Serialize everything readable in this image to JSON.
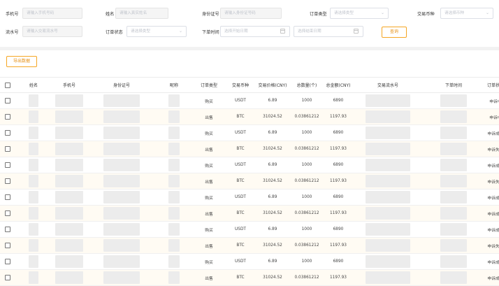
{
  "filters": {
    "phone_label": "手机号",
    "phone_placeholder": "请输入手机号码",
    "name_label": "姓名",
    "name_placeholder": "请输入真实姓名",
    "idcard_label": "身份证号",
    "idcard_placeholder": "请输入身份证号码",
    "order_type_label": "订单类型",
    "order_type_placeholder": "请选择类型",
    "trade_coin_label": "交易币种",
    "trade_coin_placeholder": "请选择币种",
    "serial_label": "流水号",
    "serial_placeholder": "请输入交易流水号",
    "order_status_label": "订单状态",
    "order_status_placeholder": "请选择类型",
    "order_time_label": "下单时间",
    "start_date_placeholder": "选择开始日期",
    "end_date_placeholder": "选择结束日期",
    "search_button": "查询"
  },
  "export_button": "导出数据",
  "table": {
    "headers": [
      "姓名",
      "手机号",
      "身份证号",
      "昵称",
      "订单类型",
      "交易币种",
      "交易价格(CNY)",
      "总数量(个)",
      "总金额(CNY)",
      "交易流水号",
      "下单时间",
      "订单状态"
    ],
    "rows": [
      {
        "type": "购买",
        "coin": "USDT",
        "price": "6.89",
        "qty": "1000",
        "amount": "6890",
        "status": "申诉中"
      },
      {
        "type": "出售",
        "coin": "BTC",
        "price": "31024.52",
        "qty": "0.03861212",
        "amount": "1197.93",
        "status": "申诉中"
      },
      {
        "type": "购买",
        "coin": "USDT",
        "price": "6.89",
        "qty": "1000",
        "amount": "6890",
        "status": "申诉成功"
      },
      {
        "type": "出售",
        "coin": "BTC",
        "price": "31024.52",
        "qty": "0.03861212",
        "amount": "1197.93",
        "status": "申诉失败"
      },
      {
        "type": "购买",
        "coin": "USDT",
        "price": "6.89",
        "qty": "1000",
        "amount": "6890",
        "status": "申诉成功"
      },
      {
        "type": "出售",
        "coin": "BTC",
        "price": "31024.52",
        "qty": "0.03861212",
        "amount": "1197.93",
        "status": "申诉失败"
      },
      {
        "type": "购买",
        "coin": "USDT",
        "price": "6.89",
        "qty": "1000",
        "amount": "6890",
        "status": "申诉成功"
      },
      {
        "type": "出售",
        "coin": "BTC",
        "price": "31024.52",
        "qty": "0.03861212",
        "amount": "1197.93",
        "status": "申诉成功"
      },
      {
        "type": "购买",
        "coin": "USDT",
        "price": "6.89",
        "qty": "1000",
        "amount": "6890",
        "status": "申诉成功"
      },
      {
        "type": "出售",
        "coin": "BTC",
        "price": "31024.52",
        "qty": "0.03861212",
        "amount": "1197.93",
        "status": "申诉失败"
      },
      {
        "type": "购买",
        "coin": "USDT",
        "price": "6.89",
        "qty": "1000",
        "amount": "6890",
        "status": "申诉成功"
      },
      {
        "type": "出售",
        "coin": "BTC",
        "price": "31024.52",
        "qty": "0.03861212",
        "amount": "1197.93",
        "status": "申诉成功"
      }
    ]
  }
}
